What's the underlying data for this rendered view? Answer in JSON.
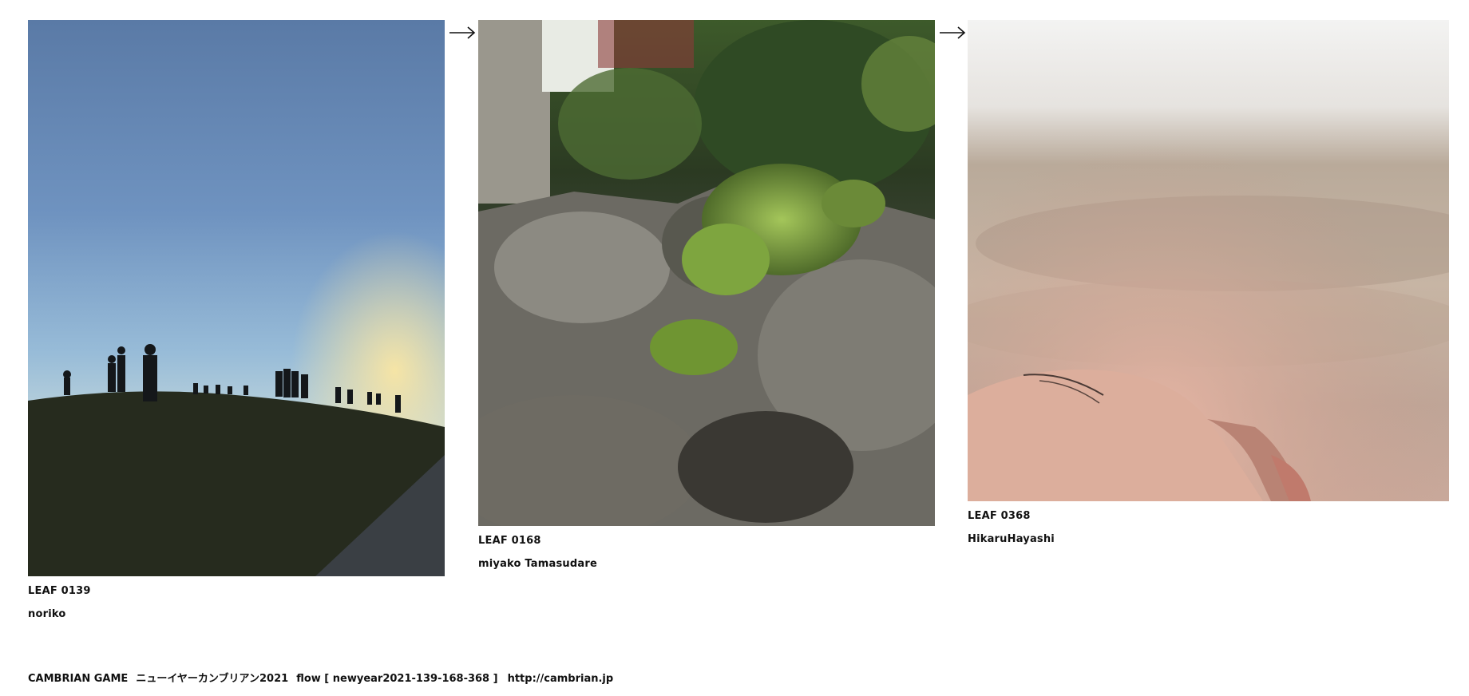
{
  "leaves": [
    {
      "id_label": "LEAF 0139",
      "author": "noriko",
      "photo_subject": "silhouettes-on-hill-at-dusk"
    },
    {
      "id_label": "LEAF 0168",
      "author": "miyako Tamasudare",
      "photo_subject": "moss-on-stones"
    },
    {
      "id_label": "LEAF 0368",
      "author": "HikaruHayashi",
      "photo_subject": "sleeping-face-closeup"
    }
  ],
  "footer": {
    "game": "CAMBRIAN GAME",
    "event": "ニューイヤーカンブリアン2021",
    "flow": "flow [ newyear2021-139-168-368 ]",
    "url": "http://cambrian.jp"
  },
  "colors": {
    "text": "#111111",
    "background": "#ffffff"
  }
}
